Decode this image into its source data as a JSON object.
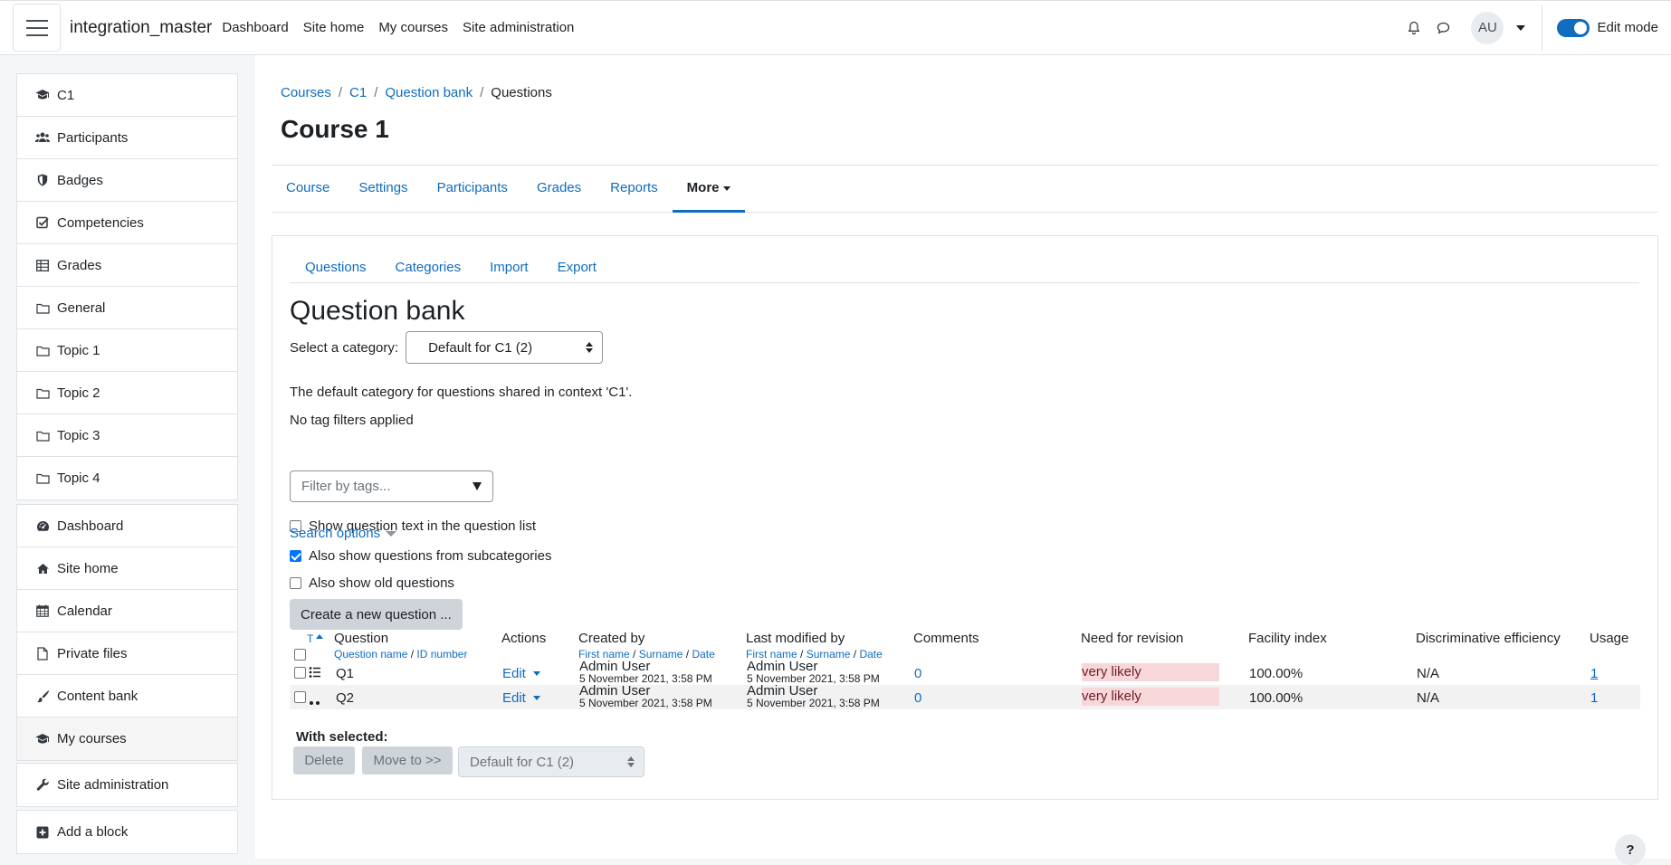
{
  "navbar": {
    "site_name": "integration_master",
    "links": [
      "Dashboard",
      "Site home",
      "My courses",
      "Site administration"
    ],
    "user_initials": "AU",
    "edit_mode_label": "Edit mode",
    "edit_mode_on": true
  },
  "drawer": {
    "course_items": [
      {
        "icon": "graduation-cap-icon",
        "label": "C1"
      },
      {
        "icon": "users-icon",
        "label": "Participants"
      },
      {
        "icon": "shield-icon",
        "label": "Badges"
      },
      {
        "icon": "check-square-icon",
        "label": "Competencies"
      },
      {
        "icon": "table-icon",
        "label": "Grades"
      },
      {
        "icon": "folder-icon",
        "label": "General"
      },
      {
        "icon": "folder-icon",
        "label": "Topic 1"
      },
      {
        "icon": "folder-icon",
        "label": "Topic 2"
      },
      {
        "icon": "folder-icon",
        "label": "Topic 3"
      },
      {
        "icon": "folder-icon",
        "label": "Topic 4"
      }
    ],
    "site_items": [
      {
        "icon": "dashboard-icon",
        "label": "Dashboard"
      },
      {
        "icon": "home-icon",
        "label": "Site home"
      },
      {
        "icon": "calendar-icon",
        "label": "Calendar"
      },
      {
        "icon": "file-icon",
        "label": "Private files"
      },
      {
        "icon": "brush-icon",
        "label": "Content bank"
      },
      {
        "icon": "graduation-cap-icon",
        "label": "My courses"
      }
    ],
    "admin_item": {
      "icon": "wrench-icon",
      "label": "Site administration"
    },
    "add_block": {
      "icon": "plus-square-icon",
      "label": "Add a block"
    }
  },
  "breadcrumb": [
    "Courses",
    "C1",
    "Question bank",
    "Questions"
  ],
  "page_title": "Course 1",
  "secondary_nav": [
    "Course",
    "Settings",
    "Participants",
    "Grades",
    "Reports",
    "More"
  ],
  "tertiary_nav": [
    "Questions",
    "Categories",
    "Import",
    "Export"
  ],
  "question_bank": {
    "title": "Question bank",
    "category_label": "Select a category:",
    "category_value": "Default for C1 (2)",
    "category_description": "The default category for questions shared in context 'C1'.",
    "tag_status": "No tag filters applied",
    "tag_filter_placeholder": "Filter by tags...",
    "show_text_label": "Show question text in the question list",
    "search_options_label": "Search options",
    "subcategories_label": "Also show questions from subcategories",
    "old_questions_label": "Also show old questions",
    "create_button": "Create a new question ..."
  },
  "table": {
    "sort_t": "T",
    "headers": {
      "question": "Question",
      "question_sub_1": "Question name",
      "question_sub_2": "ID number",
      "actions": "Actions",
      "created_by": "Created by",
      "last_modified_by": "Last modified by",
      "person_sub_1": "First name",
      "person_sub_2": "Surname",
      "person_sub_3": "Date",
      "comments": "Comments",
      "need_for_revision": "Need for revision",
      "facility_index": "Facility index",
      "discriminative_efficiency": "Discriminative efficiency",
      "usage": "Usage",
      "slash": "/"
    },
    "rows": [
      {
        "name": "Q1",
        "type_icon": "multichoice-icon",
        "edit": "Edit",
        "created_by": "Admin User",
        "created_date": "5 November 2021, 3:58 PM",
        "modified_by": "Admin User",
        "modified_date": "5 November 2021, 3:58 PM",
        "comments": "0",
        "revision": "very likely",
        "facility": "100.00%",
        "disc": "N/A",
        "usage": "1"
      },
      {
        "name": "Q2",
        "type_icon": "truefalse-icon",
        "edit": "Edit",
        "created_by": "Admin User",
        "created_date": "5 November 2021, 3:58 PM",
        "modified_by": "Admin User",
        "modified_date": "5 November 2021, 3:58 PM",
        "comments": "0",
        "revision": "very likely",
        "facility": "100.00%",
        "disc": "N/A",
        "usage": "1"
      }
    ],
    "with_selected": "With selected:",
    "delete_button": "Delete",
    "move_button": "Move to >>",
    "move_target": "Default for C1 (2)"
  },
  "help_label": "?",
  "colors": {
    "link": "#0f6cbf",
    "revision_bg": "#f8d7da",
    "button_grey": "#ced4da"
  }
}
